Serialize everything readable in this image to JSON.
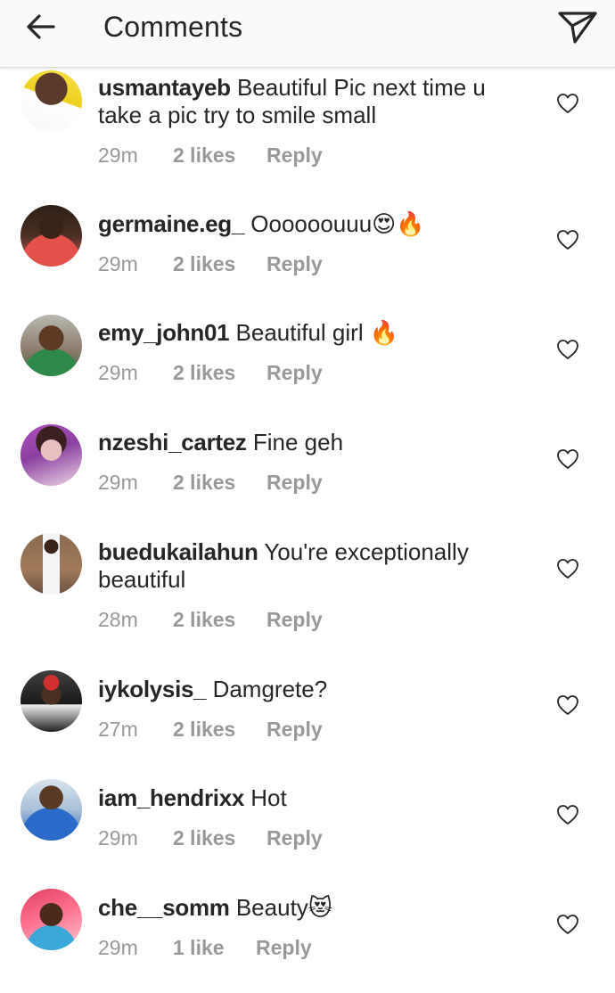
{
  "header": {
    "title": "Comments",
    "back_icon": "arrow-left-icon",
    "send_icon": "paper-plane-icon"
  },
  "colors": {
    "text": "#262626",
    "meta": "#999999",
    "header_bg": "#fafafa"
  },
  "comments": [
    {
      "username": "usmantayeb",
      "text": "Beautiful Pic  next time u take a pic try to smile small",
      "time": "29m",
      "likes": "2 likes",
      "reply": "Reply"
    },
    {
      "username": "germaine.eg_",
      "text": "Oooooouuu😍🔥",
      "time": "29m",
      "likes": "2 likes",
      "reply": "Reply"
    },
    {
      "username": "emy_john01",
      "text": "Beautiful girl 🔥",
      "time": "29m",
      "likes": "2 likes",
      "reply": "Reply"
    },
    {
      "username": "nzeshi_cartez",
      "text": "Fine geh",
      "time": "29m",
      "likes": "2 likes",
      "reply": "Reply"
    },
    {
      "username": "buedukailahun",
      "text": "You're exceptionally beautiful",
      "time": "28m",
      "likes": "2 likes",
      "reply": "Reply"
    },
    {
      "username": "iykolysis_",
      "text": "Damgrete?",
      "time": "27m",
      "likes": "2 likes",
      "reply": "Reply"
    },
    {
      "username": "iam_hendrixx",
      "text": "Hot",
      "time": "29m",
      "likes": "2 likes",
      "reply": "Reply"
    },
    {
      "username": "che__somm",
      "text": "Beauty😻",
      "time": "29m",
      "likes": "1 like",
      "reply": "Reply"
    }
  ]
}
